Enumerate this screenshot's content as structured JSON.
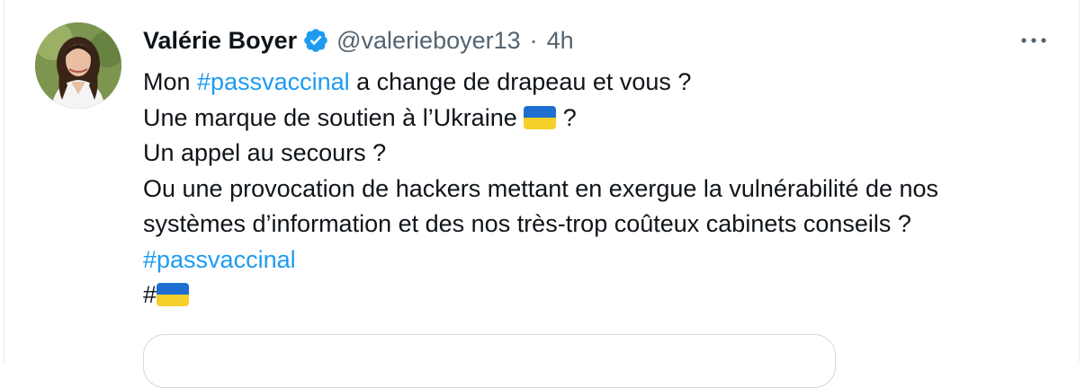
{
  "tweet": {
    "display_name": "Valérie Boyer",
    "handle": "@valerieboyer13",
    "separator": "·",
    "timestamp": "4h",
    "body": {
      "line1_before": "Mon ",
      "line1_hashtag": "#passvaccinal",
      "line1_after": " a change de drapeau et vous ?",
      "line2_before": "Une marque de soutien à l’Ukraine ",
      "line2_after": " ?",
      "line3": "Un appel au secours ?",
      "line4": "Ou une provocation de hackers mettant en exergue la vulnérabilité de  nos",
      "line5": "systèmes d’information et des nos très-trop coûteux cabinets conseils ?",
      "hashtag_line": "#passvaccinal",
      "final_prefix": "#"
    },
    "icons": {
      "verified": "verified-badge-icon",
      "flag": "ukraine-flag-icon",
      "more": "more-options-icon"
    },
    "colors": {
      "hashtag": "#1d9bf0",
      "verified": "#1d9bf0",
      "muted_text": "#536471",
      "flag_blue": "#1f6fd1",
      "flag_yellow": "#f5cf2a"
    }
  }
}
